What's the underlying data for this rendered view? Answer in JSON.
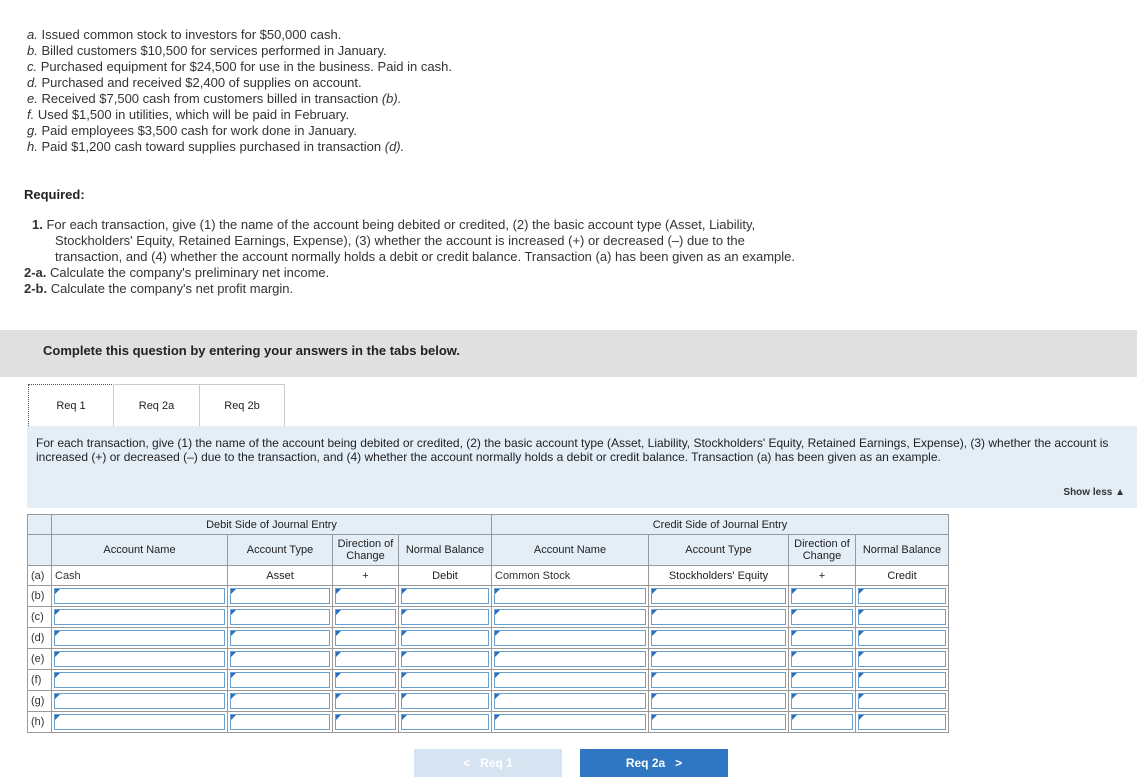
{
  "transactions": [
    {
      "letter": "a.",
      "text": "Issued common stock to investors for $50,000 cash."
    },
    {
      "letter": "b.",
      "text": "Billed customers $10,500 for services performed in January."
    },
    {
      "letter": "c.",
      "text": "Purchased equipment for $24,500 for use in the business. Paid in cash."
    },
    {
      "letter": "d.",
      "text": "Purchased and received $2,400 of supplies on account."
    },
    {
      "letter": "e.",
      "text": "Received $7,500 cash from customers billed in transaction ",
      "ref": "(b)."
    },
    {
      "letter": "f.",
      "text": "Used $1,500 in utilities, which will be paid in February."
    },
    {
      "letter": "g.",
      "text": "Paid employees $3,500 cash for work done in January."
    },
    {
      "letter": "h.",
      "text": "Paid $1,200 cash toward supplies purchased in transaction ",
      "ref": "(d)."
    }
  ],
  "required": {
    "title": "Required:",
    "items": [
      {
        "num": "1.",
        "lines": [
          "For each transaction, give (1) the name of the account being debited or credited, (2) the basic account type (Asset, Liability,",
          "Stockholders' Equity, Retained Earnings, Expense), (3) whether the account is increased (+) or decreased (–) due to the",
          "transaction, and (4) whether the account normally holds a debit or credit balance. Transaction (a) has been given as an example."
        ]
      },
      {
        "num": "2-a.",
        "lines": [
          "Calculate the company's preliminary net income."
        ]
      },
      {
        "num": "2-b.",
        "lines": [
          "Calculate the company's net profit margin."
        ]
      }
    ]
  },
  "banner": "Complete this question by entering your answers in the tabs below.",
  "tabs": [
    "Req 1",
    "Req 2a",
    "Req 2b"
  ],
  "instructions": "For each transaction, give (1) the name of the account being debited or credited, (2) the basic account type (Asset, Liability, Stockholders' Equity, Retained Earnings, Expense), (3) whether the account is increased (+) or decreased (–) due to the transaction, and (4) whether the account normally holds a debit or credit balance. Transaction (a) has been given as an example.",
  "show_less": "Show less ▲",
  "table": {
    "debit_group": "Debit Side of Journal Entry",
    "credit_group": "Credit Side of Journal Entry",
    "headers": {
      "account_name": "Account Name",
      "account_type": "Account Type",
      "direction": "Direction of Change",
      "normal_balance": "Normal Balance"
    },
    "example": {
      "label": "(a)",
      "debit_name": "Cash",
      "debit_type": "Asset",
      "debit_dir": "+",
      "debit_bal": "Debit",
      "credit_name": "Common Stock",
      "credit_type": "Stockholders' Equity",
      "credit_dir": "+",
      "credit_bal": "Credit"
    },
    "row_labels": [
      "(b)",
      "(c)",
      "(d)",
      "(e)",
      "(f)",
      "(g)",
      "(h)"
    ]
  },
  "nav": {
    "prev": "Req 1",
    "next": "Req 2a"
  }
}
